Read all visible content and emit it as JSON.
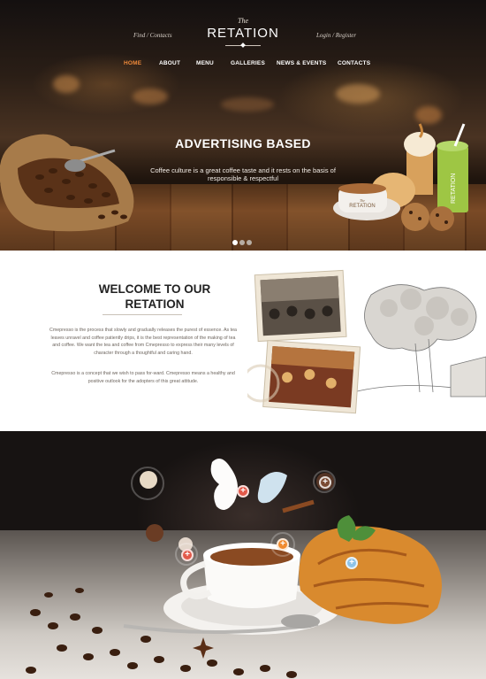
{
  "header": {
    "left_links": "Find / Contacts",
    "right_links": "Login / Register",
    "brand_small": "The",
    "brand": "RETATION"
  },
  "nav": [
    {
      "label": "HOME",
      "active": true
    },
    {
      "label": "ABOUT"
    },
    {
      "label": "MENU"
    },
    {
      "label": "GALLERIES"
    },
    {
      "label": "NEWS & EVENTS"
    },
    {
      "label": "CONTACTS"
    }
  ],
  "hero": {
    "title": "ADVERTISING BASED",
    "subtitle": "Coffee culture is a great coffee taste and it rests on the basis of responsible & respectful",
    "cup_label": "RETATION",
    "cup_label_small": "The",
    "drink_label": "RETATION",
    "slides": 3,
    "active_slide": 0
  },
  "welcome": {
    "title_line1": "WELCOME TO OUR",
    "title_line2": "RETATION",
    "paragraph1": "Cmepresso is the process that slowly and gradually releases the purest of essence. As tea leaves unravel and coffee patiently drips, it is the best representation of the making of tea and coffee. We want the tea and coffee from Cmepresso to express their many levels of character through a thoughtful and caring hand.",
    "paragraph2": "Cmepresso is a concept that we wish to pass for-ward. Cmepresso means a healthy and positive outlook for the adopters of this great attitude."
  },
  "hotspots": {
    "symbol": "+",
    "colors": {
      "orange": "#f08a2e",
      "red": "#e2594a",
      "blue": "#8dc3e8",
      "brown": "#7a4a32"
    }
  },
  "colors": {
    "accent": "#ef8a3a"
  }
}
